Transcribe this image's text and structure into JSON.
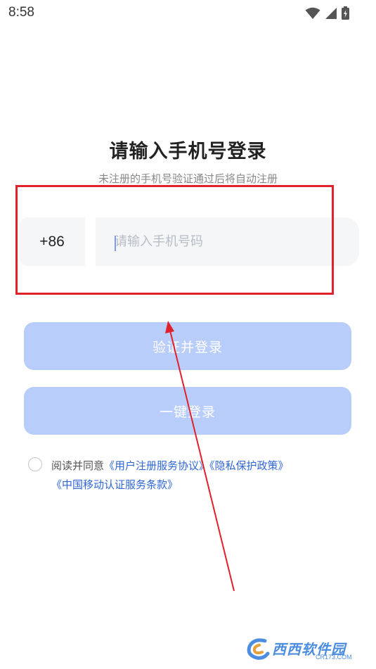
{
  "status_bar": {
    "time": "8:58",
    "icons": [
      "wifi-icon",
      "signal-icon",
      "battery-icon"
    ]
  },
  "login": {
    "title": "请输入手机号登录",
    "subtitle": "未注册的手机号验证通过后将自动注册",
    "country_code": "+86",
    "phone_placeholder": "请输入手机号码",
    "phone_value": ""
  },
  "buttons": {
    "verify_login": "验证并登录",
    "one_click_login": "一键登录"
  },
  "agreement": {
    "checked": false,
    "prefix": "阅读并同意",
    "user_agreement": "《用户注册服务协议》",
    "privacy_policy": "《隐私保护政策》",
    "cmcc_terms": "《中国移动认证服务条款》"
  },
  "watermark": {
    "brand": "西西软件园",
    "domain": "CR173.COM"
  },
  "colors": {
    "button_disabled": "#b9cdfb",
    "link": "#2f66d6",
    "annotation": "#e0212b",
    "input_bg": "#f5f6f8"
  }
}
